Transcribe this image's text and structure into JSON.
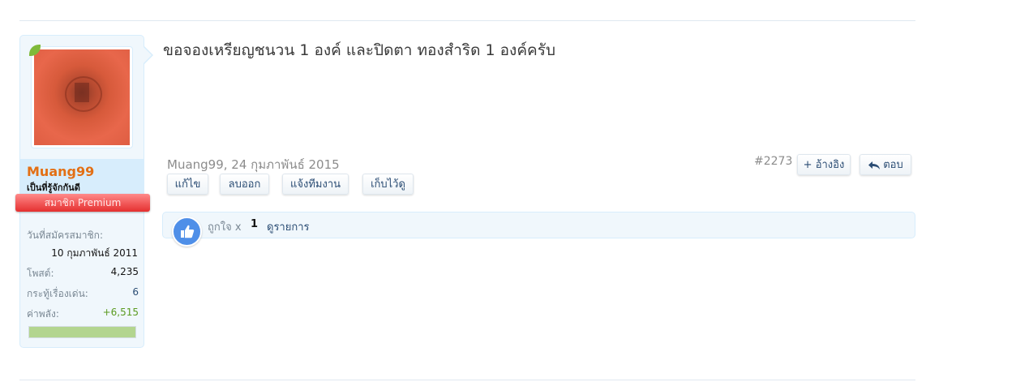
{
  "user": {
    "name": "Muang99",
    "title": "เป็นที่รู้จักกันดี",
    "ribbon": "สมาชิก Premium",
    "stats": {
      "joined_label": "วันที่สมัครสมาชิก:",
      "joined_value": "10 กุมภาพันธ์ 2011",
      "posts_label": "โพสต์:",
      "posts_value": "4,235",
      "threads_label": "กระทู้เรื่องเด่น:",
      "threads_value": "6",
      "power_label": "ค่าพลัง:",
      "power_value": "+6,515"
    },
    "power_bar_fill": 1.0
  },
  "post": {
    "message": "ขอจองเหรียญชนวน 1 องค์ และปิดตา ทองสำริด 1 องค์ครับ",
    "meta": "Muang99, 24 กุมภาพันธ์ 2015",
    "number": "#2273",
    "actions": {
      "edit": "แก้ไข",
      "delete": "ลบออก",
      "report": "แจ้งทีมงาน",
      "save": "เก็บไว้ดู"
    },
    "quote_label": "+ อ้างอิง",
    "reply_label": "ตอบ"
  },
  "likes": {
    "label": "ถูกใจ x",
    "count": "1",
    "list_link": "ดูรายการ"
  },
  "colors": {
    "username": "#e36f14",
    "link": "#2b4d74",
    "panel_bg": "#f0f7fc",
    "ribbon": "#e52f2f",
    "like_icon": "#4f8fe8",
    "power_value": "#5a9a1f",
    "power_bar": "#b3d58f"
  },
  "icons": {
    "like": "thumbs-up-icon",
    "reply": "reply-arrow-icon",
    "online": "online-status-icon"
  }
}
